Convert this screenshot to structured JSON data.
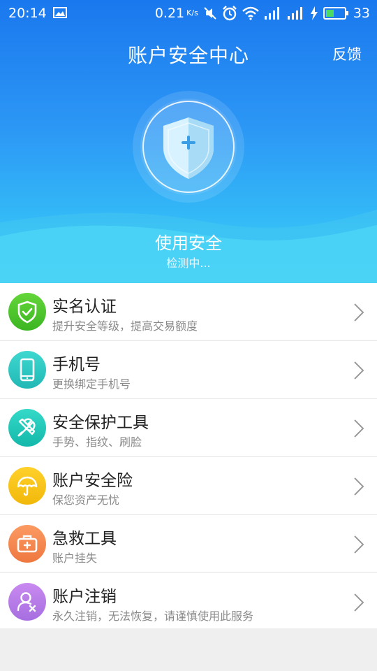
{
  "status_bar": {
    "time": "20:14",
    "net_speed": "0.21",
    "net_unit": "K/s",
    "battery": "33"
  },
  "header": {
    "title": "账户安全中心",
    "feedback": "反馈"
  },
  "hero": {
    "status": "使用安全",
    "detecting": "检测中..."
  },
  "items": [
    {
      "label": "实名认证",
      "desc": "提升安全等级，提高交易额度",
      "icon": "shield-check-icon",
      "color": "#4cc52c"
    },
    {
      "label": "手机号",
      "desc": "更换绑定手机号",
      "icon": "phone-icon",
      "color": "#2ec5c0"
    },
    {
      "label": "安全保护工具",
      "desc": "手势、指纹、刷脸",
      "icon": "tools-icon",
      "color": "#20c6b8"
    },
    {
      "label": "账户安全险",
      "desc": "保您资产无忧",
      "icon": "umbrella-icon",
      "color": "#f5c21a"
    },
    {
      "label": "急救工具",
      "desc": "账户挂失",
      "icon": "first-aid-kit-icon",
      "color": "#f48a52"
    },
    {
      "label": "账户注销",
      "desc": "永久注销，无法恢复，请谨慎使用此服务",
      "icon": "user-remove-icon",
      "color": "#b67be6"
    }
  ]
}
